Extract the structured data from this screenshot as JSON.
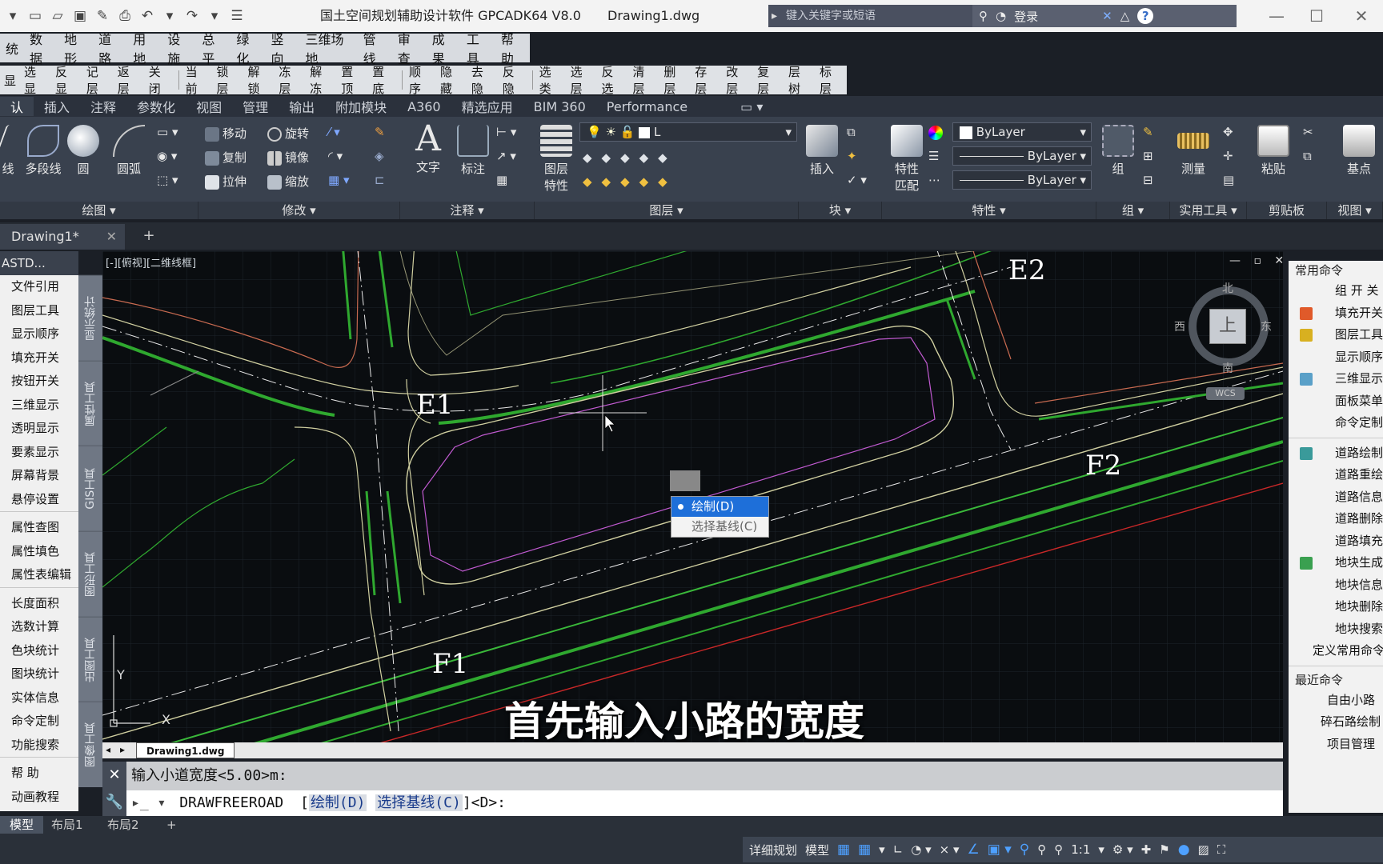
{
  "title": {
    "app": "国土空间规划辅助设计软件 GPCADK64 V8.0",
    "file": "Drawing1.dwg"
  },
  "search": {
    "placeholder": "键入关键字或短语"
  },
  "login": "登录",
  "menu": [
    "统",
    "数据",
    "地形",
    "道路",
    "用地",
    "设施",
    "总平",
    "绿化",
    "竖向",
    "三维场地",
    "管线",
    "审查",
    "成果",
    "工具",
    "帮助"
  ],
  "layer_toolbar": [
    "显",
    "选显",
    "反显",
    "记层",
    "返层",
    "关闭",
    "|",
    "当前",
    "锁层",
    "解锁",
    "冻层",
    "解冻",
    "置顶",
    "置底",
    "|",
    "顺序",
    "隐藏",
    "去隐",
    "反隐",
    "|",
    "选类",
    "选层",
    "反选",
    "清层",
    "删层",
    "存层",
    "改层",
    "复层",
    "层树",
    "标层"
  ],
  "ribbon_tabs": [
    "认",
    "插入",
    "注释",
    "参数化",
    "视图",
    "管理",
    "输出",
    "附加模块",
    "A360",
    "精选应用",
    "BIM 360",
    "Performance"
  ],
  "ribbon": {
    "draw": {
      "line": "线",
      "polyline": "多段线",
      "circle": "圆",
      "arc": "圆弧",
      "panel": "绘图 ▾"
    },
    "modify": {
      "move": "移动",
      "rotate": "旋转",
      "copy": "复制",
      "mirror": "镜像",
      "stretch": "拉伸",
      "scale": "缩放",
      "panel": "修改 ▾"
    },
    "annotate": {
      "text": "文字",
      "dim": "标注",
      "panel": "注释 ▾"
    },
    "layers": {
      "props_line1": "图层",
      "props_line2": "特性",
      "combo": "L",
      "panel": "图层 ▾"
    },
    "block": {
      "insert": "插入",
      "panel": "块 ▾"
    },
    "properties": {
      "match_line1": "特性",
      "match_line2": "匹配",
      "color": "ByLayer",
      "linetype": "ByLayer",
      "lineweight": "ByLayer",
      "panel": "特性 ▾"
    },
    "group": {
      "group": "组",
      "panel": "组 ▾"
    },
    "utilities": {
      "measure": "测量",
      "panel": "实用工具 ▾"
    },
    "clipboard": {
      "paste": "粘贴",
      "panel": "剪贴板"
    },
    "view": {
      "base": "基点",
      "panel": "视图 ▾"
    }
  },
  "doc_tab": "Drawing1*",
  "left_palette": {
    "header": "ASTD...",
    "groups": [
      [
        "文件引用",
        "图层工具",
        "显示顺序",
        "填充开关",
        "按钮开关",
        "三维显示",
        "透明显示",
        "要素显示",
        "屏幕背景",
        "悬停设置"
      ],
      [
        "属性查图",
        "属性填色",
        "属性表编辑"
      ],
      [
        "长度面积",
        "选数计算",
        "色块统计",
        "图块统计",
        "实体信息",
        "命令定制",
        "功能搜索"
      ],
      [
        "帮    助",
        "动画教程"
      ]
    ]
  },
  "vertical_tabs": [
    "显示统计",
    "属性工具",
    "GIS工具",
    "图形工具",
    "出图工具",
    "图像工具"
  ],
  "viewport_label": "[-][俯视][二维线框]",
  "viewcube": {
    "north": "北",
    "south": "南",
    "east": "东",
    "west": "西",
    "top": "上",
    "wcs": "WCS"
  },
  "points": {
    "e1": "E1",
    "e2": "E2",
    "f1": "F1",
    "f2": "F2"
  },
  "axes": {
    "y": "Y",
    "x": "X"
  },
  "context_menu": [
    {
      "label": "绘制(D)",
      "selected": true
    },
    {
      "label": "选择基线(C)",
      "selected": false
    }
  ],
  "subtitle": "首先输入小路的宽度",
  "model_tab": "Drawing1.dwg",
  "command": {
    "history": "输入小道宽度<5.00>m:",
    "name": "DRAWFREEROAD",
    "open": "[",
    "opt1": "绘制(D)",
    "opt2": "选择基线(C)",
    "tail": "]<D>:"
  },
  "right_palette": {
    "common_header": "常用命令",
    "common": [
      {
        "label": "组 开 关",
        "icon": ""
      },
      {
        "label": "填充开关",
        "icon": "#e05a2a"
      },
      {
        "label": "图层工具",
        "icon": "#d8b020"
      },
      {
        "label": "显示顺序",
        "icon": ""
      },
      {
        "label": "三维显示",
        "icon": "#5aa0c8"
      },
      {
        "label": "面板菜单",
        "icon": ""
      },
      {
        "label": "命令定制",
        "icon": ""
      }
    ],
    "road": [
      {
        "label": "道路绘制",
        "icon": "#3a9a9a"
      },
      {
        "label": "道路重绘",
        "icon": ""
      },
      {
        "label": "道路信息",
        "icon": ""
      },
      {
        "label": "道路删除",
        "icon": ""
      },
      {
        "label": "道路填充",
        "icon": ""
      },
      {
        "label": "地块生成",
        "icon": "#3aa050"
      },
      {
        "label": "地块信息",
        "icon": ""
      },
      {
        "label": "地块删除",
        "icon": ""
      },
      {
        "label": "地块搜索",
        "icon": ""
      }
    ],
    "define": "定义常用命令",
    "recent_header": "最近命令",
    "recent": [
      "自由小路",
      "碎石路绘制",
      "项目管理"
    ]
  },
  "layout_tabs": [
    "模型",
    "布局1",
    "布局2"
  ],
  "status": {
    "detail": "详细规划",
    "model": "模型",
    "scale": "1:1"
  }
}
